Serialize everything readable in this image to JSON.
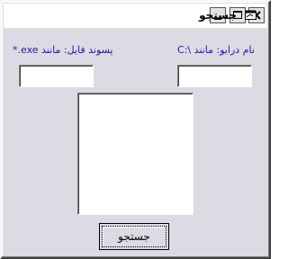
{
  "window": {
    "title": "جستجو",
    "icon": "window-icon",
    "controls": {
      "minimize": "minimize-icon",
      "maximize": "maximize-icon",
      "close": "close-icon"
    }
  },
  "form": {
    "drive_label": "نام درایو: مانند \\:C",
    "ext_label": "پسوند فایل: مانند exe.*",
    "drive_value": "",
    "ext_value": "",
    "results": [],
    "search_button": "جستجو"
  },
  "colors": {
    "window_bg": "#dcdbe3",
    "label_color": "#1a1aa8"
  }
}
